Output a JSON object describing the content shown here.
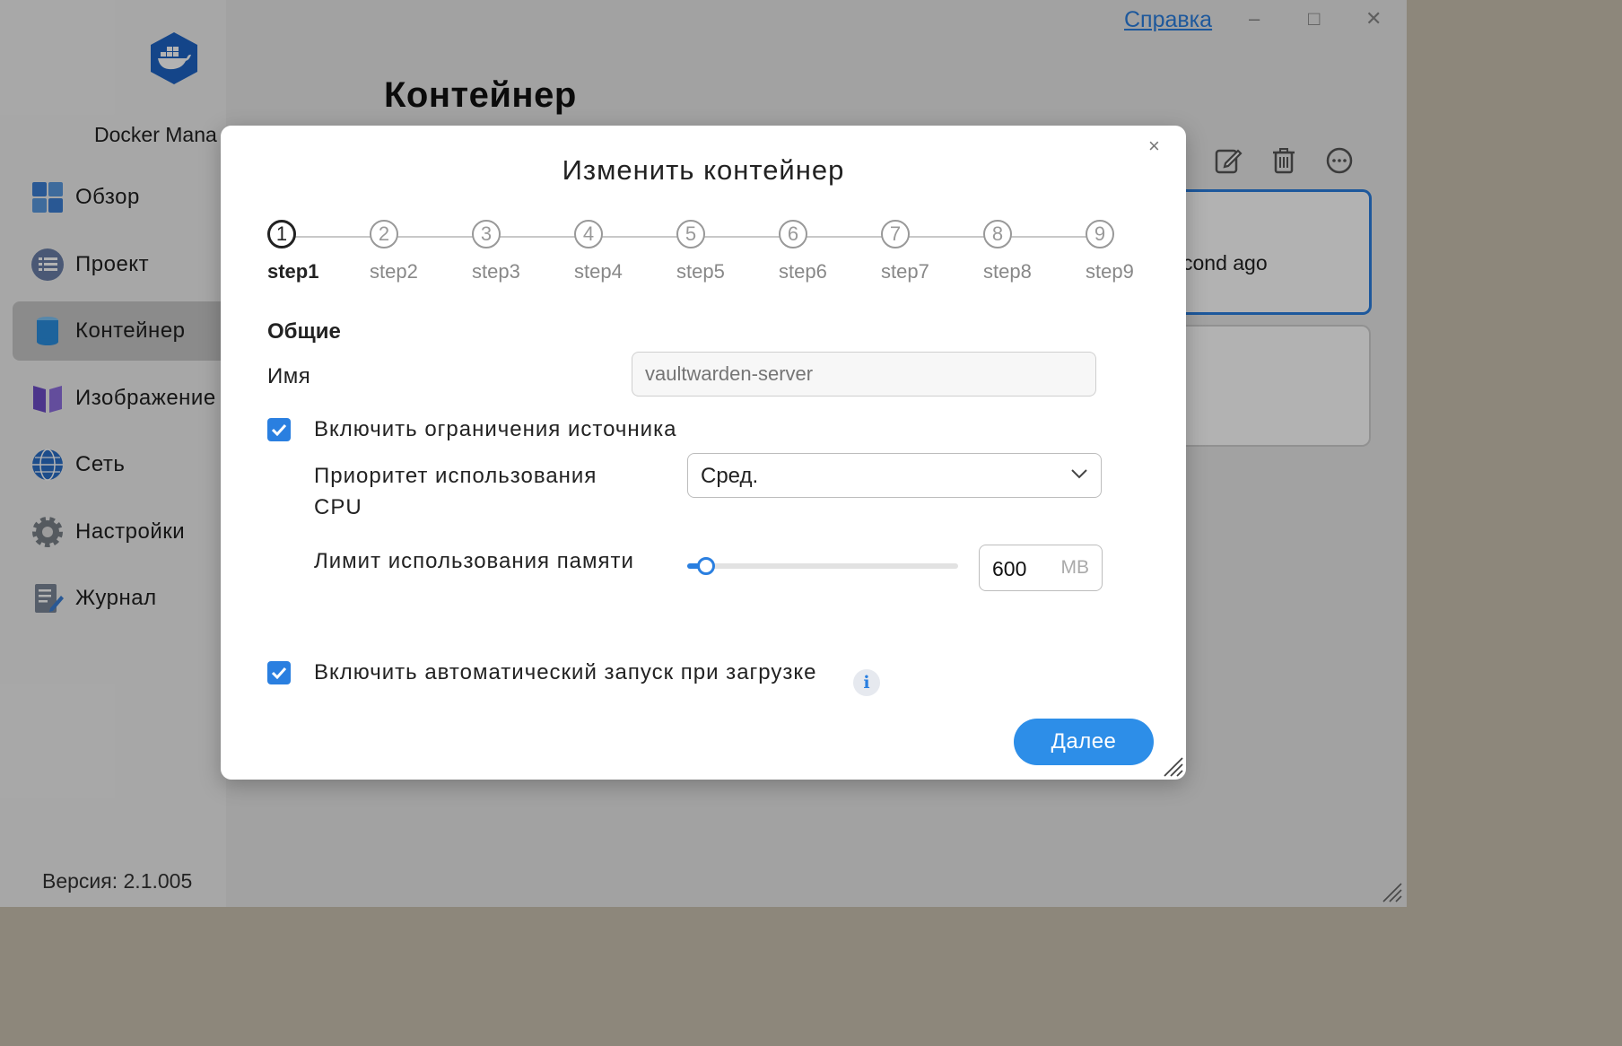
{
  "window": {
    "help_link": "Справка",
    "minimize": "–",
    "maximize": "□",
    "close": "✕"
  },
  "sidebar": {
    "app_name": "Docker Mana",
    "items": [
      {
        "label": "Обзор",
        "icon": "dashboard-icon"
      },
      {
        "label": "Проект",
        "icon": "project-list-icon"
      },
      {
        "label": "Контейнер",
        "icon": "container-icon",
        "active": true
      },
      {
        "label": "Изображение",
        "icon": "image-icon"
      },
      {
        "label": "Сеть",
        "icon": "network-globe-icon"
      },
      {
        "label": "Настройки",
        "icon": "settings-gear-icon"
      },
      {
        "label": "Журнал",
        "icon": "log-journal-icon"
      }
    ],
    "version": "Версия: 2.1.005"
  },
  "main": {
    "title": "Контейнер",
    "toolbar": [
      "edit-icon",
      "delete-icon",
      "more-icon"
    ],
    "card_text": "cond ago"
  },
  "modal": {
    "title": "Изменить контейнер",
    "close": "×",
    "steps": [
      {
        "num": "1",
        "label": "step1",
        "active": true
      },
      {
        "num": "2",
        "label": "step2"
      },
      {
        "num": "3",
        "label": "step3"
      },
      {
        "num": "4",
        "label": "step4"
      },
      {
        "num": "5",
        "label": "step5"
      },
      {
        "num": "6",
        "label": "step6"
      },
      {
        "num": "7",
        "label": "step7"
      },
      {
        "num": "8",
        "label": "step8"
      },
      {
        "num": "9",
        "label": "step9"
      }
    ],
    "section_title": "Общие",
    "name_label": "Имя",
    "name_placeholder": "vaultwarden-server",
    "resource_limit_label": "Включить ограничения источника",
    "resource_limit_checked": true,
    "cpu_label": "Приоритет использования CPU",
    "cpu_value": "Сред.",
    "memory_label": "Лимит использования памяти",
    "memory_value": "600",
    "memory_unit": "MB",
    "memory_slider_fraction": 0.07,
    "autostart_label": "Включить автоматический запуск при загрузке",
    "autostart_checked": true,
    "info": "i",
    "next_button": "Далее"
  },
  "colors": {
    "accent": "#2a7fe0",
    "button": "#2d8ee8"
  }
}
